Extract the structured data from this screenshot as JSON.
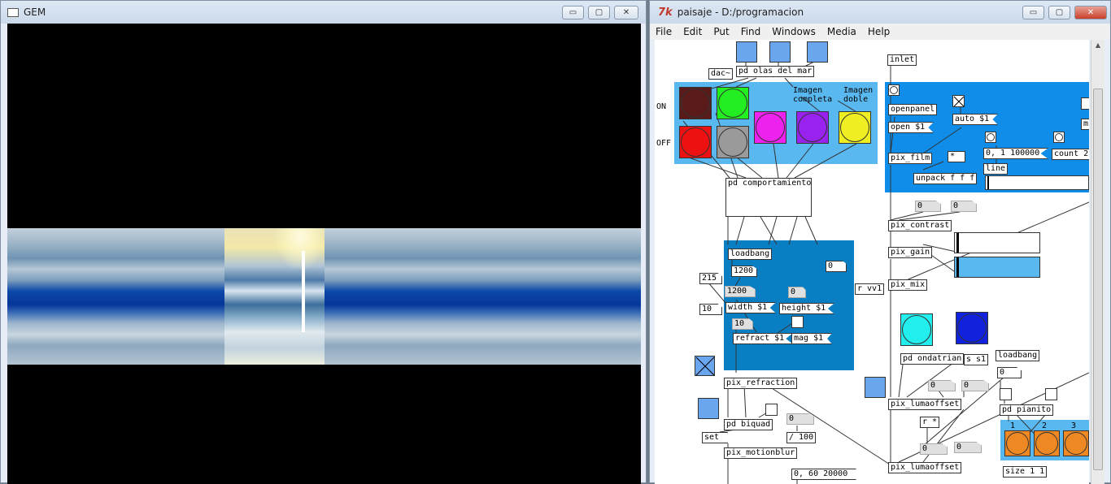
{
  "gem": {
    "title": "GEM"
  },
  "pd_window": {
    "title": "paisaje - D:/programacion",
    "menu": [
      "File",
      "Edit",
      "Put",
      "Find",
      "Windows",
      "Media",
      "Help"
    ]
  },
  "window_controls": {
    "minimize": "▭",
    "maximize": "▢",
    "close": "✕"
  },
  "patch": {
    "objects": {
      "inlet": "inlet",
      "dac": "dac~",
      "olas": "pd olas del mar",
      "comportamiento": "pd comportamiento",
      "openpanel": "openpanel",
      "open": "open $1",
      "auto": "auto $1",
      "pix_film": "pix_film",
      "range": "0, 1 100000",
      "count": "count 2",
      "line": "line",
      "unpack": "unpack f f f",
      "pix_contrast": "pix_contrast",
      "pix_gain": "pix_gain",
      "pix_mix": "pix_mix",
      "r_vv1": "r vv1",
      "loadbang1": "loadbang",
      "n1200a": "1200",
      "n1200b": "1200",
      "width": "width $1",
      "height": "height $1",
      "n10": "10",
      "refract": "refract $1",
      "mag": "mag $1",
      "n215": "215",
      "n10b": "10",
      "pix_refraction": "pix_refraction",
      "pd_biquad": "pd biquad",
      "set": "set",
      "div100": "/ 100",
      "pix_motionblur": "pix_motionblur",
      "m60": "0, 60 20000",
      "pd_ondatrian": "pd ondatrian",
      "s_s1": "s s1",
      "loadbang2": "loadbang",
      "pix_lumaoffset1": "pix_lumaoffset",
      "pix_lumaoffset2": "pix_lumaoffset",
      "r_star": "r *",
      "pd_pianito": "pd pianito",
      "size": "size 1 1",
      "star": "*",
      "m": "m"
    },
    "numbers": {
      "zero_top": "0",
      "zero_h": "0",
      "zero_r": "0",
      "c1": "0",
      "c2": "0",
      "lo1": "0",
      "lo2": "0",
      "lo3": "0",
      "lo4": "0",
      "lb2": "0",
      "b1": "0"
    },
    "labels": {
      "on": "ON",
      "off": "OFF",
      "imagen_completa": "Imagen\ncompleta",
      "imagen_doble": "Imagen\ndoble",
      "p1": "1",
      "p2": "2",
      "p3": "3"
    }
  },
  "colors": {
    "canvas_light_blue": "#5ab8f0",
    "canvas_mid_blue": "#0a7ec2",
    "canvas_blue": "#108de8",
    "bang_darkred": "#5a1a1a",
    "bang_green": "#22ee22",
    "bang_red": "#ee1111",
    "bang_gray": "#9a9a9a",
    "bang_magenta": "#ee22ee",
    "bang_purple": "#9922ee",
    "bang_yellow": "#eeee22",
    "bang_cyan": "#22eeee",
    "bang_navy": "#1122dd",
    "bang_orange": "#ee8822"
  }
}
